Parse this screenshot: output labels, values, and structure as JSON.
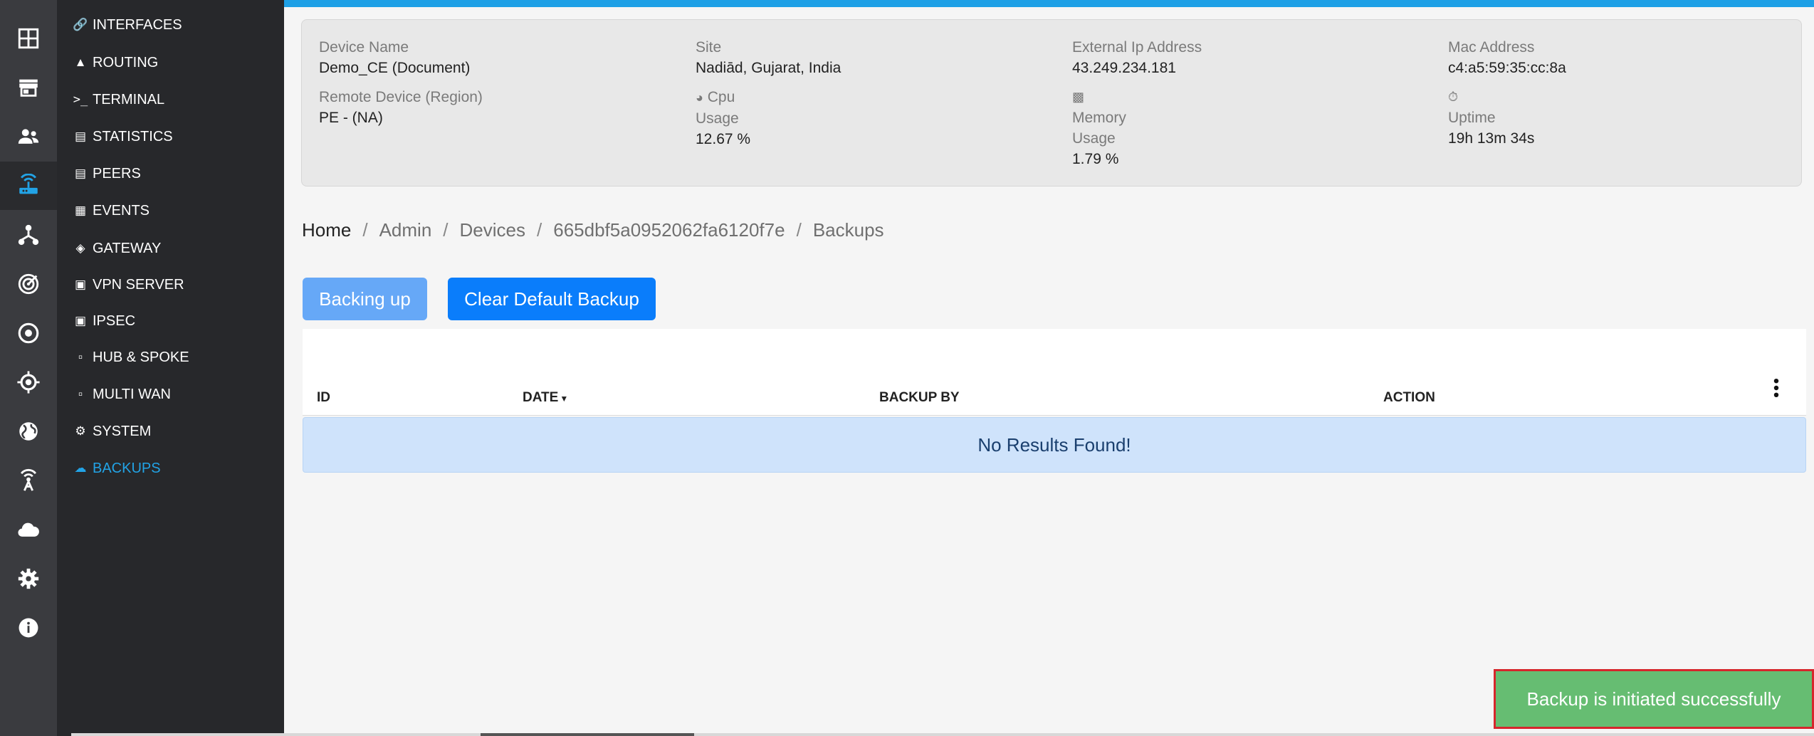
{
  "colors": {
    "accent": "#1ea0e6",
    "primary_button": "#0a7dfb",
    "toast": "#66bd72"
  },
  "rail": {
    "icons": [
      "dashboard-icon",
      "store-icon",
      "users-icon",
      "router-icon",
      "topology-icon",
      "radar-icon",
      "target-icon",
      "crosshair-icon",
      "globe-icon",
      "antenna-icon",
      "cloud-icon",
      "gear-icon",
      "info-icon"
    ]
  },
  "submenu": {
    "items": [
      {
        "label": "INTERFACES",
        "icon": "link-icon"
      },
      {
        "label": "ROUTING",
        "icon": "road-icon"
      },
      {
        "label": "TERMINAL",
        "icon": "terminal-icon"
      },
      {
        "label": "STATISTICS",
        "icon": "chart-icon"
      },
      {
        "label": "PEERS",
        "icon": "chart-icon"
      },
      {
        "label": "EVENTS",
        "icon": "calendar-icon"
      },
      {
        "label": "GATEWAY",
        "icon": "wifi-icon"
      },
      {
        "label": "VPN SERVER",
        "icon": "window-icon"
      },
      {
        "label": "IPSEC",
        "icon": "window-icon"
      },
      {
        "label": "HUB & SPOKE",
        "icon": "book-icon"
      },
      {
        "label": "MULTI WAN",
        "icon": "book-icon"
      },
      {
        "label": "SYSTEM",
        "icon": "gear-icon"
      },
      {
        "label": "BACKUPS",
        "icon": "cloud-upload-icon"
      }
    ]
  },
  "device": {
    "name_label": "Device Name",
    "name_value": "Demo_CE (Document)",
    "site_label": "Site",
    "site_value": "Nadiād, Gujarat, India",
    "ext_ip_label": "External Ip Address",
    "ext_ip_value": "43.249.234.181",
    "mac_label": "Mac Address",
    "mac_value": "c4:a5:59:35:cc:8a",
    "remote_label": "Remote Device (Region)",
    "remote_value": "PE - (NA)",
    "cpu_label": "Cpu",
    "cpu_usage_label": "Usage",
    "cpu_value": "12.67 %",
    "memory_label": "Memory",
    "memory_usage_label": "Usage",
    "memory_value": "1.79 %",
    "uptime_label": "Uptime",
    "uptime_value": "19h 13m 34s"
  },
  "breadcrumb": {
    "home": "Home",
    "sep": "/",
    "admin": "Admin",
    "devices": "Devices",
    "device_id": "665dbf5a0952062fa6120f7e",
    "current": "Backups"
  },
  "actions": {
    "backing_up": "Backing up",
    "clear_default": "Clear Default Backup"
  },
  "table": {
    "columns": [
      "ID",
      "DATE",
      "BACKUP BY",
      "ACTION"
    ],
    "empty_message": "No Results Found!"
  },
  "toast": {
    "message": "Backup is initiated successfully"
  }
}
